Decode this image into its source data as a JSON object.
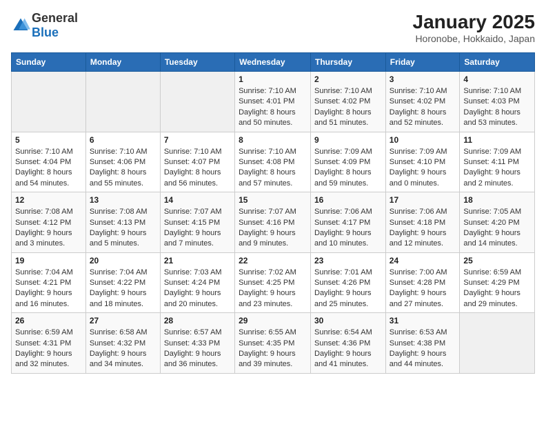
{
  "header": {
    "logo_general": "General",
    "logo_blue": "Blue",
    "month_year": "January 2025",
    "location": "Horonobe, Hokkaido, Japan"
  },
  "days_of_week": [
    "Sunday",
    "Monday",
    "Tuesday",
    "Wednesday",
    "Thursday",
    "Friday",
    "Saturday"
  ],
  "weeks": [
    [
      {
        "day": "",
        "info": ""
      },
      {
        "day": "",
        "info": ""
      },
      {
        "day": "",
        "info": ""
      },
      {
        "day": "1",
        "info": "Sunrise: 7:10 AM\nSunset: 4:01 PM\nDaylight: 8 hours\nand 50 minutes."
      },
      {
        "day": "2",
        "info": "Sunrise: 7:10 AM\nSunset: 4:02 PM\nDaylight: 8 hours\nand 51 minutes."
      },
      {
        "day": "3",
        "info": "Sunrise: 7:10 AM\nSunset: 4:02 PM\nDaylight: 8 hours\nand 52 minutes."
      },
      {
        "day": "4",
        "info": "Sunrise: 7:10 AM\nSunset: 4:03 PM\nDaylight: 8 hours\nand 53 minutes."
      }
    ],
    [
      {
        "day": "5",
        "info": "Sunrise: 7:10 AM\nSunset: 4:04 PM\nDaylight: 8 hours\nand 54 minutes."
      },
      {
        "day": "6",
        "info": "Sunrise: 7:10 AM\nSunset: 4:06 PM\nDaylight: 8 hours\nand 55 minutes."
      },
      {
        "day": "7",
        "info": "Sunrise: 7:10 AM\nSunset: 4:07 PM\nDaylight: 8 hours\nand 56 minutes."
      },
      {
        "day": "8",
        "info": "Sunrise: 7:10 AM\nSunset: 4:08 PM\nDaylight: 8 hours\nand 57 minutes."
      },
      {
        "day": "9",
        "info": "Sunrise: 7:09 AM\nSunset: 4:09 PM\nDaylight: 8 hours\nand 59 minutes."
      },
      {
        "day": "10",
        "info": "Sunrise: 7:09 AM\nSunset: 4:10 PM\nDaylight: 9 hours\nand 0 minutes."
      },
      {
        "day": "11",
        "info": "Sunrise: 7:09 AM\nSunset: 4:11 PM\nDaylight: 9 hours\nand 2 minutes."
      }
    ],
    [
      {
        "day": "12",
        "info": "Sunrise: 7:08 AM\nSunset: 4:12 PM\nDaylight: 9 hours\nand 3 minutes."
      },
      {
        "day": "13",
        "info": "Sunrise: 7:08 AM\nSunset: 4:13 PM\nDaylight: 9 hours\nand 5 minutes."
      },
      {
        "day": "14",
        "info": "Sunrise: 7:07 AM\nSunset: 4:15 PM\nDaylight: 9 hours\nand 7 minutes."
      },
      {
        "day": "15",
        "info": "Sunrise: 7:07 AM\nSunset: 4:16 PM\nDaylight: 9 hours\nand 9 minutes."
      },
      {
        "day": "16",
        "info": "Sunrise: 7:06 AM\nSunset: 4:17 PM\nDaylight: 9 hours\nand 10 minutes."
      },
      {
        "day": "17",
        "info": "Sunrise: 7:06 AM\nSunset: 4:18 PM\nDaylight: 9 hours\nand 12 minutes."
      },
      {
        "day": "18",
        "info": "Sunrise: 7:05 AM\nSunset: 4:20 PM\nDaylight: 9 hours\nand 14 minutes."
      }
    ],
    [
      {
        "day": "19",
        "info": "Sunrise: 7:04 AM\nSunset: 4:21 PM\nDaylight: 9 hours\nand 16 minutes."
      },
      {
        "day": "20",
        "info": "Sunrise: 7:04 AM\nSunset: 4:22 PM\nDaylight: 9 hours\nand 18 minutes."
      },
      {
        "day": "21",
        "info": "Sunrise: 7:03 AM\nSunset: 4:24 PM\nDaylight: 9 hours\nand 20 minutes."
      },
      {
        "day": "22",
        "info": "Sunrise: 7:02 AM\nSunset: 4:25 PM\nDaylight: 9 hours\nand 23 minutes."
      },
      {
        "day": "23",
        "info": "Sunrise: 7:01 AM\nSunset: 4:26 PM\nDaylight: 9 hours\nand 25 minutes."
      },
      {
        "day": "24",
        "info": "Sunrise: 7:00 AM\nSunset: 4:28 PM\nDaylight: 9 hours\nand 27 minutes."
      },
      {
        "day": "25",
        "info": "Sunrise: 6:59 AM\nSunset: 4:29 PM\nDaylight: 9 hours\nand 29 minutes."
      }
    ],
    [
      {
        "day": "26",
        "info": "Sunrise: 6:59 AM\nSunset: 4:31 PM\nDaylight: 9 hours\nand 32 minutes."
      },
      {
        "day": "27",
        "info": "Sunrise: 6:58 AM\nSunset: 4:32 PM\nDaylight: 9 hours\nand 34 minutes."
      },
      {
        "day": "28",
        "info": "Sunrise: 6:57 AM\nSunset: 4:33 PM\nDaylight: 9 hours\nand 36 minutes."
      },
      {
        "day": "29",
        "info": "Sunrise: 6:55 AM\nSunset: 4:35 PM\nDaylight: 9 hours\nand 39 minutes."
      },
      {
        "day": "30",
        "info": "Sunrise: 6:54 AM\nSunset: 4:36 PM\nDaylight: 9 hours\nand 41 minutes."
      },
      {
        "day": "31",
        "info": "Sunrise: 6:53 AM\nSunset: 4:38 PM\nDaylight: 9 hours\nand 44 minutes."
      },
      {
        "day": "",
        "info": ""
      }
    ]
  ]
}
